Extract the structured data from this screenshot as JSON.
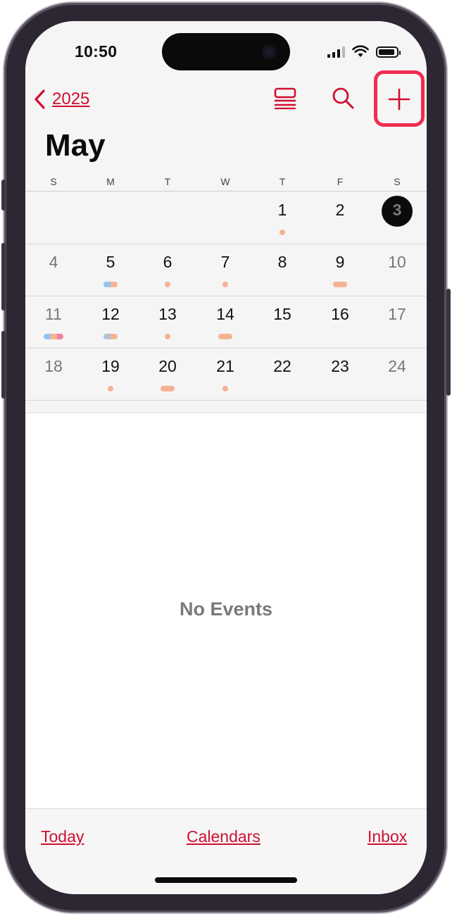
{
  "status_bar": {
    "time": "10:50"
  },
  "nav": {
    "back_label": "2025"
  },
  "month_title": "May",
  "weekday_labels": [
    "S",
    "M",
    "T",
    "W",
    "T",
    "F",
    "S"
  ],
  "weeks": [
    [
      {
        "day": "",
        "dots": []
      },
      {
        "day": "",
        "dots": []
      },
      {
        "day": "",
        "dots": []
      },
      {
        "day": "",
        "dots": []
      },
      {
        "day": "1",
        "dots": [
          "#f5b393"
        ]
      },
      {
        "day": "2",
        "dots": []
      },
      {
        "day": "3",
        "dots": [],
        "today": true
      }
    ],
    [
      {
        "day": "4",
        "dots": []
      },
      {
        "day": "5",
        "dots": [
          "#92c4f2",
          "#f5b393"
        ]
      },
      {
        "day": "6",
        "dots": [
          "#f5b393"
        ]
      },
      {
        "day": "7",
        "dots": [
          "#f5b393"
        ]
      },
      {
        "day": "8",
        "dots": []
      },
      {
        "day": "9",
        "dots": [
          "#f5b393",
          "#f5b393"
        ]
      },
      {
        "day": "10",
        "dots": []
      }
    ],
    [
      {
        "day": "11",
        "dots": [
          "#92c4f2",
          "#f5b393",
          "#f27fa3"
        ]
      },
      {
        "day": "12",
        "dots": [
          "#b0c4d6",
          "#f5b393"
        ]
      },
      {
        "day": "13",
        "dots": [
          "#f5b393"
        ]
      },
      {
        "day": "14",
        "dots": [
          "#f5b393",
          "#f5b393"
        ]
      },
      {
        "day": "15",
        "dots": []
      },
      {
        "day": "16",
        "dots": []
      },
      {
        "day": "17",
        "dots": []
      }
    ],
    [
      {
        "day": "18",
        "dots": []
      },
      {
        "day": "19",
        "dots": [
          "#f5b393"
        ]
      },
      {
        "day": "20",
        "dots": [
          "#f5b393",
          "#f5b393"
        ]
      },
      {
        "day": "21",
        "dots": [
          "#f5b393"
        ]
      },
      {
        "day": "22",
        "dots": []
      },
      {
        "day": "23",
        "dots": []
      },
      {
        "day": "24",
        "dots": []
      }
    ]
  ],
  "empty_state": "No Events",
  "toolbar": {
    "today": "Today",
    "calendars": "Calendars",
    "inbox": "Inbox"
  },
  "icons": {
    "back": "chevron-left-icon",
    "view": "list-view-icon",
    "search": "search-icon",
    "add": "plus-icon"
  },
  "colors": {
    "accent": "#d10e2f",
    "highlight": "#ef2d4f"
  }
}
